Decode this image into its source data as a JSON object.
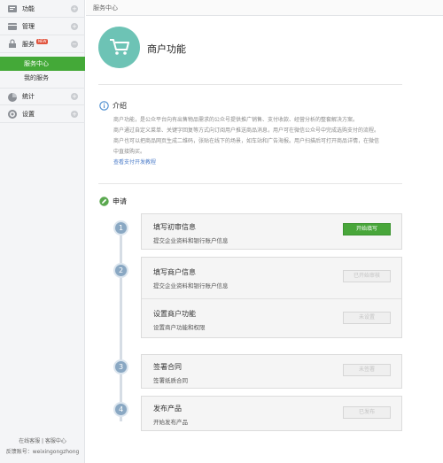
{
  "sidebar": {
    "items": [
      {
        "label": "功能",
        "icon": "feature-icon"
      },
      {
        "label": "管理",
        "icon": "manage-icon"
      },
      {
        "label": "服务",
        "icon": "service-icon",
        "badge": "NEW"
      },
      {
        "label": "统计",
        "icon": "stats-icon"
      },
      {
        "label": "设置",
        "icon": "settings-icon"
      }
    ],
    "sub_items": [
      {
        "label": "服务中心",
        "active": true
      },
      {
        "label": "我的服务",
        "active": false
      }
    ],
    "footer_line1": "在线客服 | 客服中心",
    "footer_line2": "反馈账号：weixingongzhong"
  },
  "breadcrumb": "服务中心",
  "header": {
    "title": "商户功能",
    "icon": "cart-icon",
    "accent": "#6dc3b5"
  },
  "intro": {
    "title": "介绍",
    "lines": [
      "商户功能，是公众平台向有出售物品需求的公众号提供推广销售、支付收款、经营分析的整套解决方案。",
      "商户通过自定义菜单、关键字回复等方式向订阅用户推送商品消息，用户可在微信公众号中完成选购支付的流程。",
      "商户也可以把商品网页生成二维码，张贴在线下的场景，如车站和广告海报。用户扫描后可打开商品详情，在微信",
      "中直接购买。"
    ],
    "link": "查看支付开发教程"
  },
  "apply": {
    "title": "申请",
    "steps": [
      {
        "num": "1",
        "rows": [
          {
            "title": "填写初审信息",
            "desc": "提交企业资料和银行账户信息",
            "button": "开始填写",
            "enabled": true
          }
        ]
      },
      {
        "num": "2",
        "rows": [
          {
            "title": "填写商户信息",
            "desc": "提交企业资料和银行账户信息",
            "button": "已开始审核",
            "enabled": false
          },
          {
            "title": "设置商户功能",
            "desc": "设置商户功能和权限",
            "button": "未设置",
            "enabled": false
          }
        ]
      },
      {
        "num": "3",
        "rows": [
          {
            "title": "签署合同",
            "desc": "签署纸质合同",
            "button": "未签署",
            "enabled": false
          }
        ]
      },
      {
        "num": "4",
        "rows": [
          {
            "title": "发布产品",
            "desc": "开始发布产品",
            "button": "已发布",
            "enabled": false
          }
        ]
      }
    ]
  },
  "colors": {
    "primary": "#48a63a",
    "active_nav": "#44a938",
    "step": "#8aa8c3",
    "link": "#4a7bc8"
  }
}
